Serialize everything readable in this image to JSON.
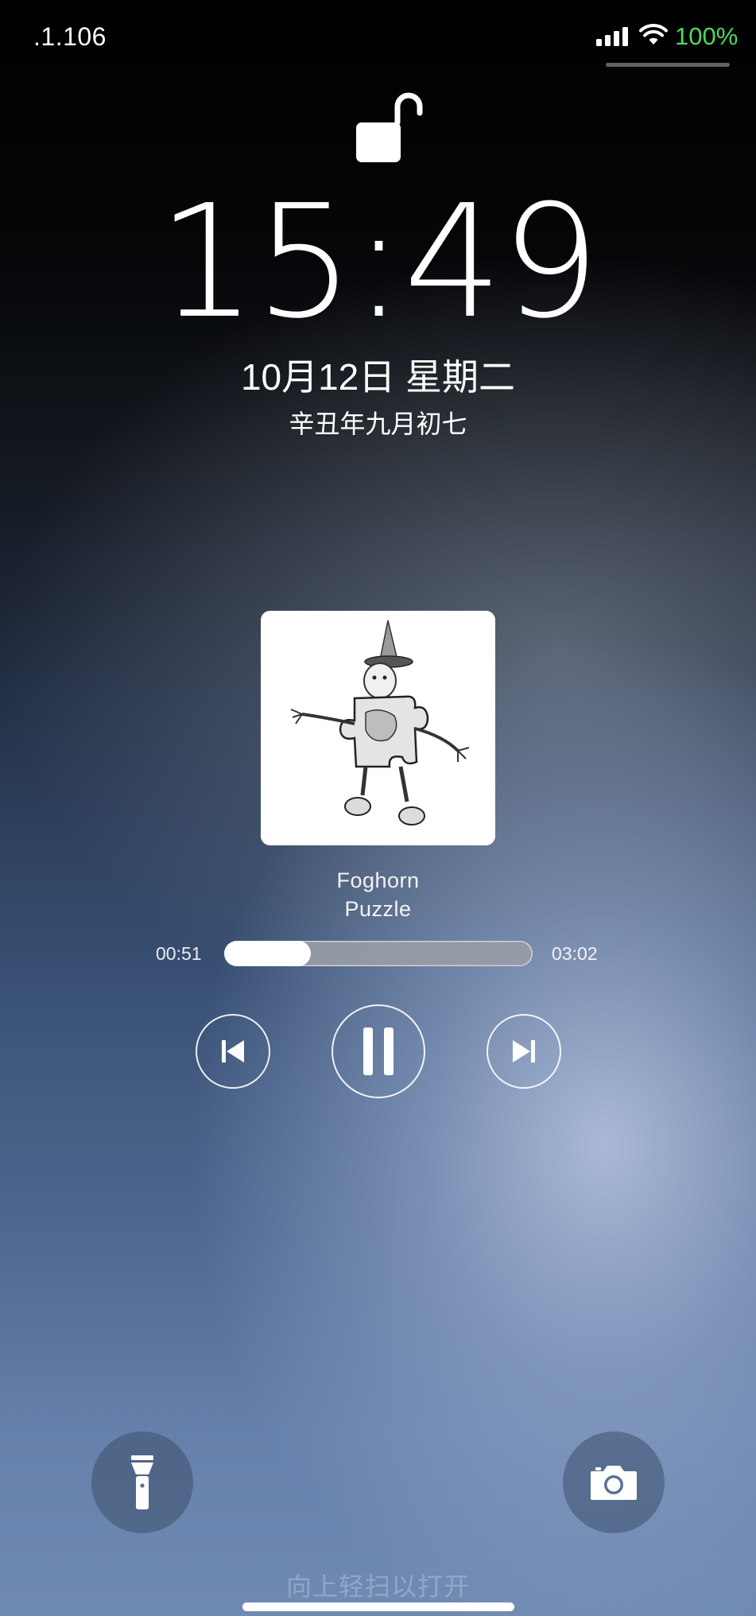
{
  "status_bar": {
    "time": ".1.106",
    "battery_percent": "100%",
    "battery_color": "#4cd964"
  },
  "lock_screen": {
    "lock_state_icon": "unlocked-padlock-icon",
    "clock": "15:49",
    "date": "10月12日 星期二",
    "lunar_date": "辛丑年九月初七"
  },
  "now_playing": {
    "title": "Foghorn",
    "artist": "Puzzle",
    "elapsed": "00:51",
    "duration": "03:02",
    "progress_fraction": 0.28,
    "controls": [
      "previous-track-icon",
      "pause-icon",
      "next-track-icon"
    ]
  },
  "shortcuts": {
    "left": "flashlight-icon",
    "right": "camera-icon"
  },
  "footer": {
    "swipe_hint": "向上轻扫以打开"
  }
}
